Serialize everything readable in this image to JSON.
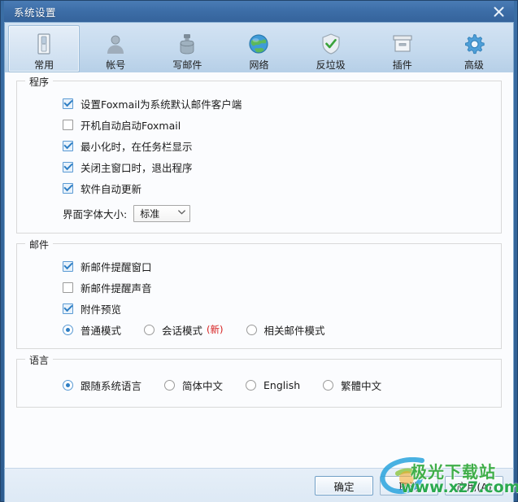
{
  "window": {
    "title": "系统设置",
    "close_icon": "close-icon",
    "titlebar_color": "#3d6ea8",
    "accent_color": "#2e7ec4"
  },
  "tabs": [
    {
      "label": "常用",
      "icon": "switch-icon",
      "selected": true
    },
    {
      "label": "帐号",
      "icon": "user-icon",
      "selected": false
    },
    {
      "label": "写邮件",
      "icon": "inkwell-icon",
      "selected": false
    },
    {
      "label": "网络",
      "icon": "globe-icon",
      "selected": false
    },
    {
      "label": "反垃圾",
      "icon": "shield-check-icon",
      "selected": false
    },
    {
      "label": "插件",
      "icon": "box-icon",
      "selected": false
    },
    {
      "label": "高级",
      "icon": "gear-icon",
      "selected": false
    }
  ],
  "groups": {
    "program": {
      "legend": "程序",
      "checkboxes": [
        {
          "label": "设置Foxmail为系统默认邮件客户端",
          "checked": true
        },
        {
          "label": "开机自动启动Foxmail",
          "checked": false
        },
        {
          "label": "最小化时，在任务栏显示",
          "checked": true
        },
        {
          "label": "关闭主窗口时，退出程序",
          "checked": true
        },
        {
          "label": "软件自动更新",
          "checked": true
        }
      ],
      "font_size": {
        "label": "界面字体大小:",
        "value": "标准",
        "chevron": "▼"
      }
    },
    "mail": {
      "legend": "邮件",
      "checkboxes": [
        {
          "label": "新邮件提醒窗口",
          "checked": true
        },
        {
          "label": "新邮件提醒声音",
          "checked": false
        },
        {
          "label": "附件预览",
          "checked": true
        }
      ],
      "modes": [
        {
          "label": "普通模式",
          "selected": true,
          "badge": ""
        },
        {
          "label": "会话模式",
          "selected": false,
          "badge": "(新)"
        },
        {
          "label": "相关邮件模式",
          "selected": false,
          "badge": ""
        }
      ]
    },
    "language": {
      "legend": "语言",
      "options": [
        {
          "label": "跟随系统语言",
          "selected": true
        },
        {
          "label": "简体中文",
          "selected": false
        },
        {
          "label": "English",
          "selected": false
        },
        {
          "label": "繁體中文",
          "selected": false
        }
      ]
    }
  },
  "footer": {
    "ok": "确定",
    "cancel": "取消",
    "apply": "应用(A)"
  },
  "watermark": {
    "top_text": "极光下载站",
    "bottom_text": "www.xz7.com"
  }
}
